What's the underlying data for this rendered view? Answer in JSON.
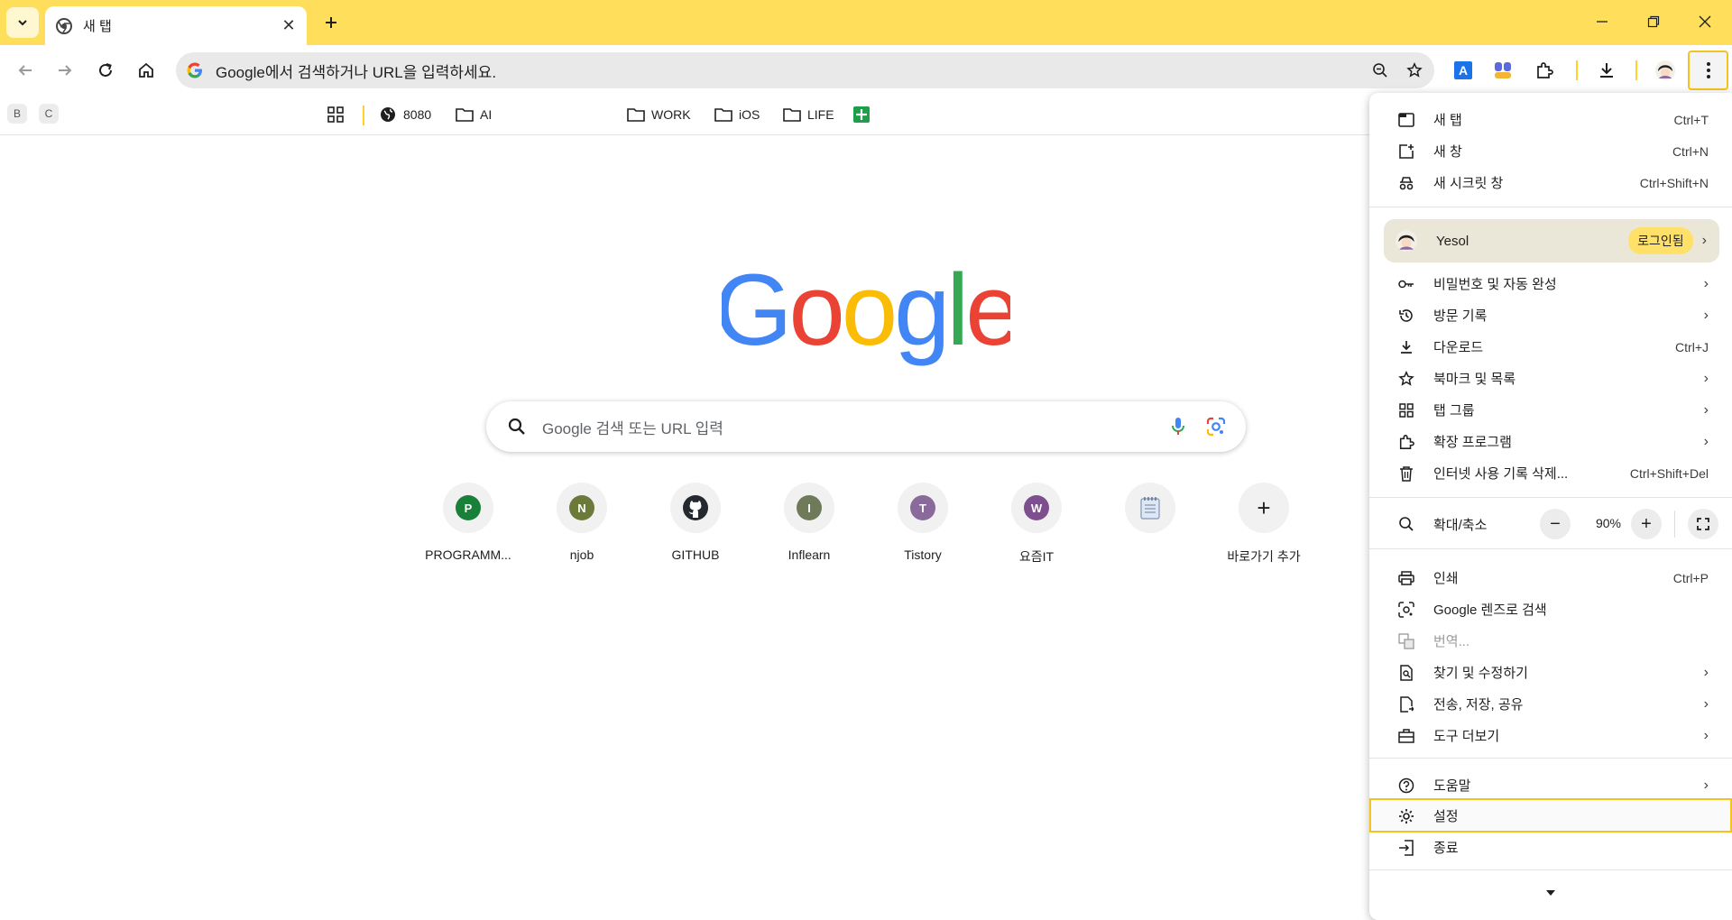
{
  "tab": {
    "title": "새 탭"
  },
  "omnibox": {
    "text": "Google에서 검색하거나 URL을 입력하세요."
  },
  "bookmarks": {
    "chips": [
      "B",
      "C"
    ],
    "items": [
      {
        "label": "8080",
        "icon": "globe-icon"
      },
      {
        "label": "AI",
        "icon": "folder-icon"
      },
      {
        "label": "WORK",
        "icon": "folder-icon"
      },
      {
        "label": "iOS",
        "icon": "folder-icon"
      },
      {
        "label": "LIFE",
        "icon": "folder-icon"
      }
    ]
  },
  "search": {
    "placeholder": "Google 검색 또는 URL 입력"
  },
  "shortcuts": [
    {
      "label": "PROGRAMM...",
      "letter": "P",
      "color": "#188038"
    },
    {
      "label": "njob",
      "letter": "N",
      "color": "#6b7a3a"
    },
    {
      "label": "GITHUB",
      "letter": "",
      "color": "#24292f"
    },
    {
      "label": "Inflearn",
      "letter": "I",
      "color": "#6f7a5a"
    },
    {
      "label": "Tistory",
      "letter": "T",
      "color": "#8a6a9a"
    },
    {
      "label": "요즘IT",
      "letter": "W",
      "color": "#7e4f8e"
    },
    {
      "label": "",
      "letter": "",
      "color": "#c9d6e8"
    },
    {
      "label": "바로가기 추가",
      "letter": "+",
      "color": "#f1f1f1"
    }
  ],
  "menu": {
    "group1": [
      {
        "label": "새 탭",
        "shortcut": "Ctrl+T"
      },
      {
        "label": "새 창",
        "shortcut": "Ctrl+N"
      },
      {
        "label": "새 시크릿 창",
        "shortcut": "Ctrl+Shift+N"
      }
    ],
    "profile": {
      "name": "Yesol",
      "badge": "로그인됨"
    },
    "group2": [
      {
        "label": "비밀번호 및 자동 완성",
        "shortcut": ""
      },
      {
        "label": "방문 기록",
        "shortcut": ""
      },
      {
        "label": "다운로드",
        "shortcut": "Ctrl+J"
      },
      {
        "label": "북마크 및 목록",
        "shortcut": ""
      },
      {
        "label": "탭 그룹",
        "shortcut": ""
      },
      {
        "label": "확장 프로그램",
        "shortcut": ""
      },
      {
        "label": "인터넷 사용 기록 삭제...",
        "shortcut": "Ctrl+Shift+Del"
      }
    ],
    "zoom": {
      "label": "확대/축소",
      "value": "90%",
      "minus": "−",
      "plus": "+"
    },
    "group3": [
      {
        "label": "인쇄",
        "shortcut": "Ctrl+P"
      },
      {
        "label": "Google 렌즈로 검색",
        "shortcut": ""
      },
      {
        "label": "번역...",
        "shortcut": ""
      },
      {
        "label": "찾기 및 수정하기",
        "shortcut": ""
      },
      {
        "label": "전송, 저장, 공유",
        "shortcut": ""
      },
      {
        "label": "도구 더보기",
        "shortcut": ""
      }
    ],
    "group4": [
      {
        "label": "도움말",
        "shortcut": ""
      },
      {
        "label": "설정",
        "shortcut": ""
      },
      {
        "label": "종료",
        "shortcut": ""
      }
    ]
  }
}
